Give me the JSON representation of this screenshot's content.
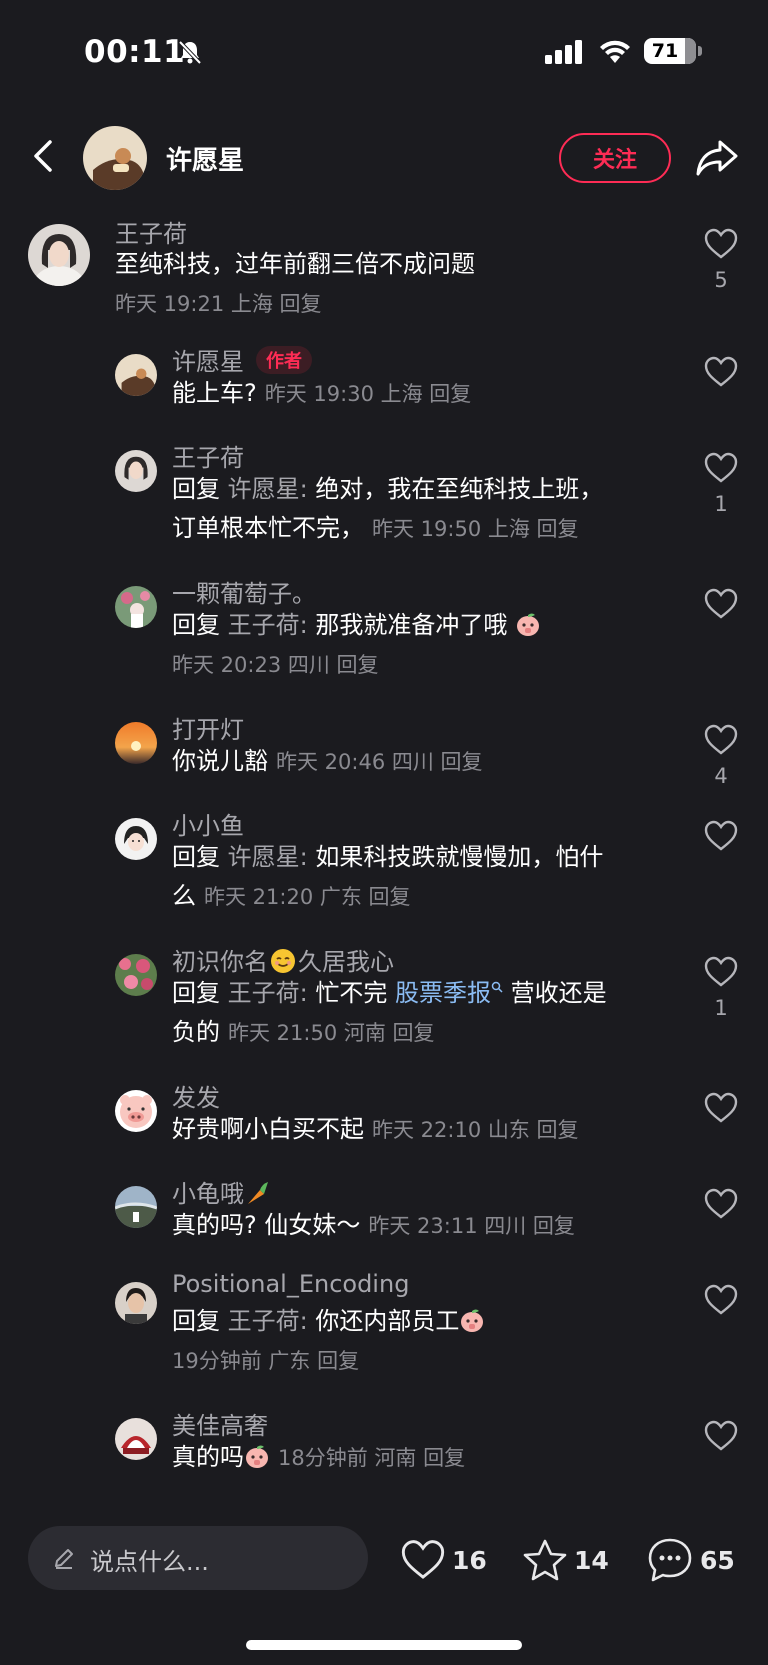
{
  "status_bar": {
    "time": "00:11",
    "battery": "71"
  },
  "header": {
    "author": "许愿星",
    "follow_label": "关注"
  },
  "comments": [
    {
      "name": "王子荷",
      "text": "至纯科技，过年前翻三倍不成问题",
      "meta": "昨天 19:21 上海 回复",
      "likes": "5"
    },
    {
      "name": "许愿星",
      "badge": "作者",
      "text": "能上车?",
      "meta": "昨天 19:30 上海 回复",
      "likes": ""
    },
    {
      "name": "王子荷",
      "reply_prefix": "回复",
      "reply_to": "许愿星:",
      "text": "绝对，我在至纯科技上班，",
      "text2": "订单根本忙不完，",
      "meta": "昨天 19:50 上海 回复",
      "likes": "1"
    },
    {
      "name": "一颗葡萄子。",
      "reply_prefix": "回复",
      "reply_to": "王子荷:",
      "text": "那我就准备冲了哦",
      "meta": "昨天 20:23 四川 回复",
      "likes": ""
    },
    {
      "name": "打开灯",
      "text": "你说儿豁",
      "meta": "昨天 20:46 四川 回复",
      "likes": "4"
    },
    {
      "name": "小小鱼",
      "reply_prefix": "回复",
      "reply_to": "许愿星:",
      "text": "如果科技跌就慢慢加，怕什",
      "text2": "么",
      "meta": "昨天 21:20 广东 回复",
      "likes": ""
    },
    {
      "name": "初识你名",
      "name_suffix": "久居我心",
      "reply_prefix": "回复",
      "reply_to": "王子荷:",
      "text": "忙不完",
      "topic": "股票季报",
      "text_after": "营收还是",
      "text2": "负的",
      "meta": "昨天 21:50 河南 回复",
      "likes": "1"
    },
    {
      "name": "发发",
      "text": "好贵啊小白买不起",
      "meta": "昨天 22:10 山东 回复",
      "likes": ""
    },
    {
      "name": "小龟哦",
      "text": "真的吗? 仙女妹～",
      "meta": "昨天 23:11 四川 回复",
      "likes": ""
    },
    {
      "name": "Positional_Encoding",
      "reply_prefix": "回复",
      "reply_to": "王子荷:",
      "text": "你还内部员工",
      "meta": "19分钟前 广东 回复",
      "likes": ""
    },
    {
      "name": "美佳高奢",
      "text": "真的吗",
      "meta": "18分钟前 河南 回复",
      "likes": ""
    }
  ],
  "bottom_bar": {
    "placeholder": "说点什么...",
    "like_count": "16",
    "fav_count": "14",
    "comment_count": "65"
  },
  "colors": {
    "accent": "#fe2c55",
    "background": "#1b1b1f",
    "secondary_text": "#a7a7ad",
    "topic": "#8bbcf3"
  }
}
